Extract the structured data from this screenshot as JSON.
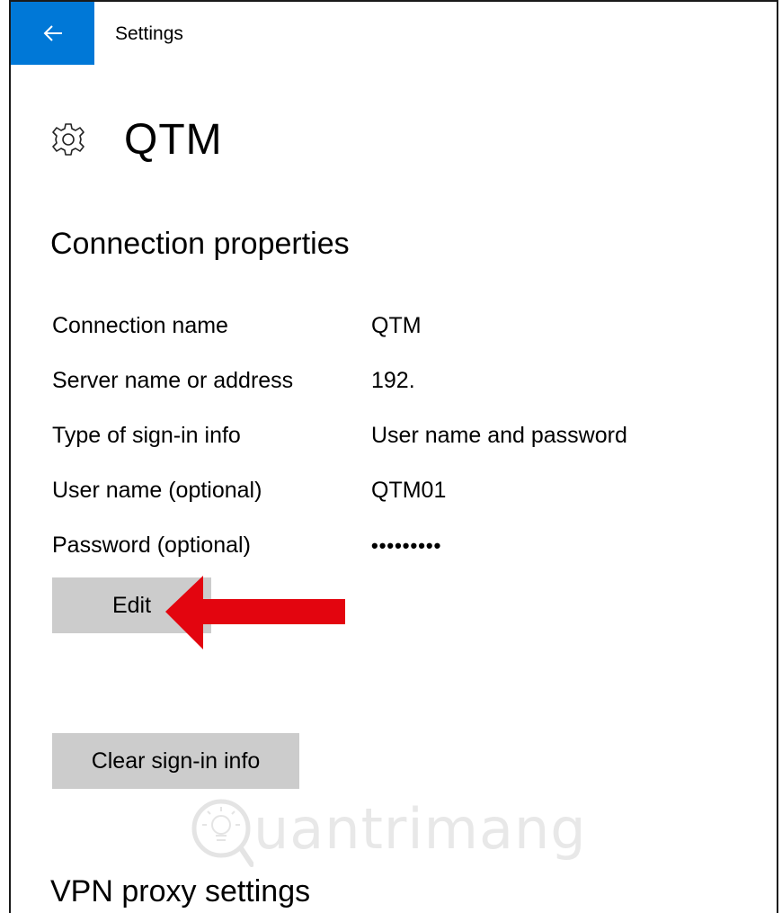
{
  "titlebar": {
    "back_icon": "back-arrow-icon",
    "title": "Settings",
    "accent_color": "#0078d7"
  },
  "header": {
    "icon": "gear-icon",
    "title": "QTM"
  },
  "connection_properties": {
    "heading": "Connection properties",
    "rows": [
      {
        "label": "Connection name",
        "value": "QTM"
      },
      {
        "label": "Server name or address",
        "value": "192."
      },
      {
        "label": "Type of sign-in info",
        "value": "User name and password"
      },
      {
        "label": "User name (optional)",
        "value": "QTM01"
      },
      {
        "label": "Password (optional)",
        "value": "•••••••••"
      }
    ],
    "edit_label": "Edit",
    "annotation": {
      "icon": "red-arrow-icon",
      "color": "#e3050f"
    }
  },
  "clear_signin_label": "Clear sign-in info",
  "vpn_proxy": {
    "heading": "VPN proxy settings"
  },
  "watermark": {
    "icon": "lightbulb-logo-icon",
    "text": "uantrimang"
  }
}
